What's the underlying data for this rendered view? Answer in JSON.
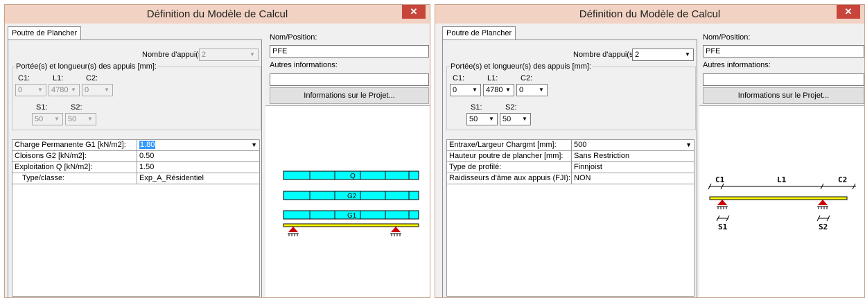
{
  "window_title": "Définition du Modèle de Calcul",
  "close_glyph": "✕",
  "tab_label": "Poutre de Plancher",
  "nb_appuis_label": "Nombre d'appui(s):",
  "portees_label": "Portée(s) et longueur(s) des appuis [mm]:",
  "nom_position_label": "Nom/Position:",
  "nom_position_value": "PFE",
  "autres_info_label": "Autres informations:",
  "autres_info_value": "",
  "projet_button": "Informations sur le Projet...",
  "spans": {
    "c1_label": "C1:",
    "l1_label": "L1:",
    "c2_label": "C2:",
    "s1_label": "S1:",
    "s2_label": "S2:",
    "c1": "0",
    "l1": "4780",
    "c2": "0",
    "s1": "50",
    "s2": "50"
  },
  "left_window": {
    "nb_appuis": "2",
    "grid": [
      {
        "label": "Charge Permanente G1 [kN/m2]:",
        "value": "1.80"
      },
      {
        "label": "Cloisons G2 [kN/m2]:",
        "value": "0.50"
      },
      {
        "label": "Exploitation Q [kN/m2]:",
        "value": "1.50"
      },
      {
        "label": "Type/classe:",
        "value": "Exp_A_Résidentiel"
      }
    ],
    "diagram": {
      "loads": [
        "Q",
        "G2",
        "G1"
      ],
      "bar_color": "#00ffff",
      "beam_color": "#ffff00",
      "support_color": "#cc0000"
    }
  },
  "right_window": {
    "nb_appuis": "2",
    "grid": [
      {
        "label": "Entraxe/Largeur Chargmt [mm]:",
        "value": "500"
      },
      {
        "label": "Hauteur poutre de plancher [mm]:",
        "value": "Sans Restriction"
      },
      {
        "label": "Type de profilé:",
        "value": "Finnjoist"
      },
      {
        "label": "Raidisseurs d'âme aux appuis (FJI):",
        "value": "NON"
      }
    ],
    "diagram": {
      "c1": "C1",
      "l1": "L1",
      "c2": "C2",
      "s1": "S1",
      "s2": "S2"
    }
  }
}
